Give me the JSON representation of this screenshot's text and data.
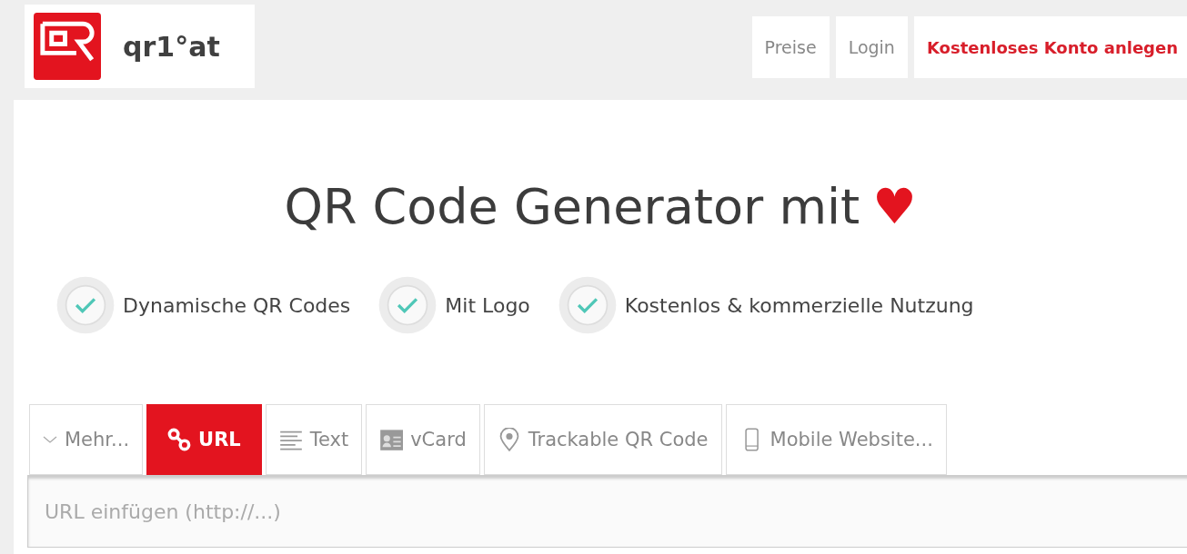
{
  "logo": {
    "text": "qr1°at"
  },
  "nav": [
    {
      "label": "Preise",
      "kind": "plain"
    },
    {
      "label": "Login",
      "kind": "plain"
    },
    {
      "label": "Kostenloses Konto anlegen",
      "kind": "highlight"
    }
  ],
  "headline": {
    "text": "QR Code Generator mit",
    "symbol": "♥"
  },
  "features": [
    {
      "label": "Dynamische QR Codes",
      "checked": true
    },
    {
      "label": "Mit Logo",
      "checked": true
    },
    {
      "label": "Kostenlos & kommerzielle Nutzung",
      "checked": true
    }
  ],
  "tabs": [
    {
      "label": "Mehr...",
      "kind": "more",
      "selected": false
    },
    {
      "label": "URL",
      "kind": "url",
      "selected": true
    },
    {
      "label": "Text",
      "kind": "text",
      "selected": false
    },
    {
      "label": "vCard",
      "kind": "vcard",
      "selected": false
    },
    {
      "label": "Trackable QR Code",
      "kind": "location",
      "selected": false
    },
    {
      "label": "Mobile Website...",
      "kind": "mobile",
      "selected": false
    }
  ],
  "url_field": {
    "placeholder": "URL einfügen (http://...)"
  }
}
